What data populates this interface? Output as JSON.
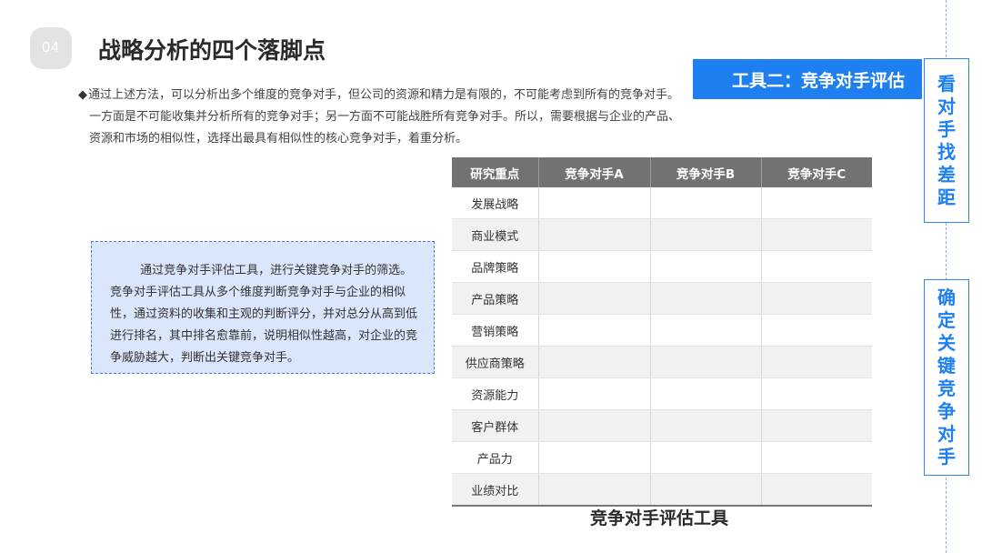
{
  "header": {
    "badge": "04",
    "title": "战略分析的四个落脚点"
  },
  "intro": {
    "bullet": "◆",
    "line1": "通过上述方法，可以分析出多个维度的竞争对手，但公司的资源和精力是有限的，不可能考虑到所有的竞争对手。",
    "line2": "一方面是不可能收集并分析所有的竞争对手；另一方面不可能战胜所有竞争对手。所以，需要根据与企业的产品、",
    "line3": "资源和市场的相似性，选择出最具有相似性的核心竞争对手，着重分析。"
  },
  "note": {
    "text": "        通过竞争对手评估工具，进行关键竞争对手的筛选。竞争对手评估工具从多个维度判断竞争对手与企业的相似性，通过资料的收集和主观的判断评分，并对总分从高到低进行排名，其中排名愈靠前，说明相似性越高，对企业的竞争威胁越大，判断出关键竞争对手。"
  },
  "table": {
    "headers": [
      "研究重点",
      "竞争对手A",
      "竞争对手B",
      "竞争对手C"
    ],
    "rows": [
      "发展战略",
      "商业模式",
      "品牌策略",
      "产品策略",
      "营销策略",
      "供应商策略",
      "资源能力",
      "客户群体",
      "产品力",
      "业绩对比"
    ],
    "caption": "竞争对手评估工具"
  },
  "tool_bar": {
    "label": "工具二：竞争对手评估"
  },
  "side_boxes": [
    {
      "chars": [
        "看",
        "对",
        "手",
        "找",
        "差",
        "距"
      ]
    },
    {
      "chars": [
        "确",
        "定",
        "关",
        "键",
        "竞",
        "争",
        "对",
        "手"
      ]
    }
  ],
  "colors": {
    "accent": "#1e7ff0",
    "header_gray": "#727272",
    "note_bg": "#d9e6fb"
  }
}
